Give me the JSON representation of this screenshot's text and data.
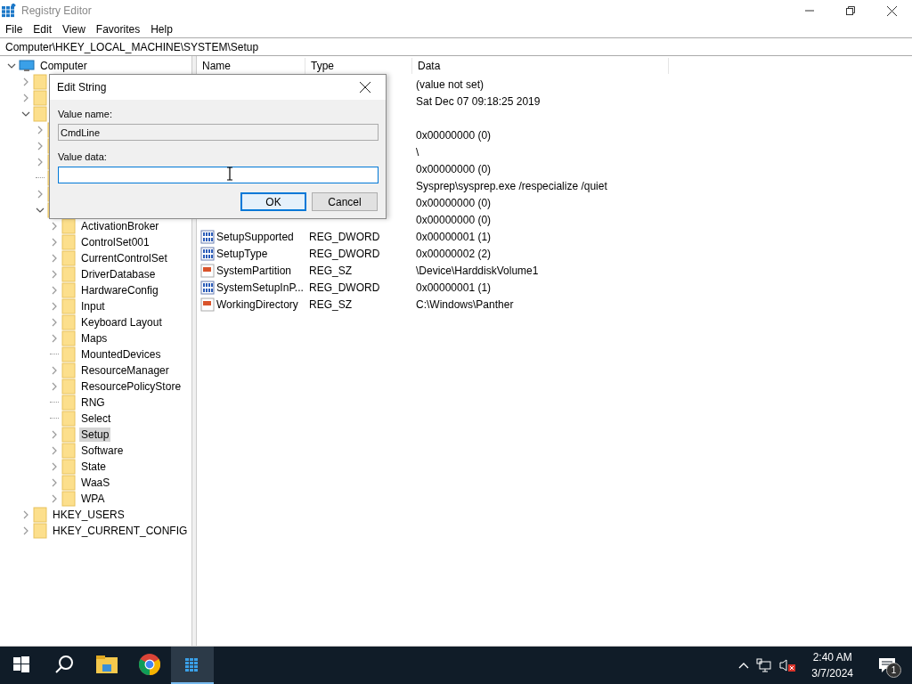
{
  "window": {
    "title": "Registry Editor"
  },
  "menu": [
    "File",
    "Edit",
    "View",
    "Favorites",
    "Help"
  ],
  "address": "Computer\\HKEY_LOCAL_MACHINE\\SYSTEM\\Setup",
  "tree": [
    {
      "label": "Computer",
      "expanded": true,
      "kind": "computer",
      "children": [
        {
          "kind": "key",
          "expanded": false
        },
        {
          "kind": "key",
          "expanded": false
        },
        {
          "kind": "key",
          "expanded": true,
          "children": [
            {
              "kind": "key",
              "expanded": false
            },
            {
              "kind": "key",
              "expanded": false
            },
            {
              "kind": "key",
              "expanded": false
            },
            {
              "kind": "key"
            },
            {
              "kind": "key",
              "expanded": false
            },
            {
              "kind": "key",
              "expanded": true,
              "children": [
                {
                  "kind": "key",
                  "label": "ActivationBroker",
                  "expanded": false,
                  "selected": false
                },
                {
                  "kind": "key",
                  "label": "ControlSet001",
                  "expanded": false,
                  "selected": false
                },
                {
                  "kind": "key",
                  "label": "CurrentControlSet",
                  "expanded": false,
                  "selected": false
                },
                {
                  "kind": "key",
                  "label": "DriverDatabase",
                  "expanded": false,
                  "selected": false
                },
                {
                  "kind": "key",
                  "label": "HardwareConfig",
                  "expanded": false,
                  "selected": false
                },
                {
                  "kind": "key",
                  "label": "Input",
                  "expanded": false,
                  "selected": false
                },
                {
                  "kind": "key",
                  "label": "Keyboard Layout",
                  "expanded": false,
                  "selected": false
                },
                {
                  "kind": "key",
                  "label": "Maps",
                  "expanded": false,
                  "selected": false
                },
                {
                  "kind": "key",
                  "label": "MountedDevices",
                  "selected": false
                },
                {
                  "kind": "key",
                  "label": "ResourceManager",
                  "expanded": false,
                  "selected": false
                },
                {
                  "kind": "key",
                  "label": "ResourcePolicyStore",
                  "expanded": false,
                  "selected": false
                },
                {
                  "kind": "key",
                  "label": "RNG",
                  "selected": false
                },
                {
                  "kind": "key",
                  "label": "Select",
                  "selected": false
                },
                {
                  "kind": "key",
                  "label": "Setup",
                  "expanded": false,
                  "selected": true
                },
                {
                  "kind": "key",
                  "label": "Software",
                  "expanded": false,
                  "selected": false
                },
                {
                  "kind": "key",
                  "label": "State",
                  "expanded": false,
                  "selected": false
                },
                {
                  "kind": "key",
                  "label": "WaaS",
                  "expanded": false,
                  "selected": false
                },
                {
                  "kind": "key",
                  "label": "WPA",
                  "expanded": false,
                  "selected": false
                }
              ]
            }
          ]
        },
        {
          "kind": "key",
          "label": "HKEY_USERS",
          "expanded": false,
          "selected": false
        },
        {
          "kind": "key",
          "label": "HKEY_CURRENT_CONFIG",
          "expanded": false,
          "selected": false
        }
      ]
    }
  ],
  "columns": [
    "Name",
    "Type",
    "Data"
  ],
  "rows": [
    {
      "data": "(value not set)"
    },
    {
      "data": "Sat Dec 07 09:18:25 2019"
    },
    {},
    {
      "data": "0x00000000 (0)"
    },
    {
      "data": "\\"
    },
    {
      "data": "0x00000000 (0)"
    },
    {
      "data": "Sysprep\\sysprep.exe /respecialize /quiet"
    },
    {
      "data": "0x00000000 (0)"
    },
    {
      "data": "0x00000000 (0)"
    },
    {
      "kind": "dword",
      "name": "SetupSupported",
      "type": "REG_DWORD",
      "data": "0x00000001 (1)"
    },
    {
      "kind": "dword",
      "name": "SetupType",
      "type": "REG_DWORD",
      "data": "0x00000002 (2)"
    },
    {
      "kind": "string",
      "name": "SystemPartition",
      "type": "REG_SZ",
      "data": "\\Device\\HarddiskVolume1"
    },
    {
      "kind": "dword",
      "name": "SystemSetupInP...",
      "type": "REG_DWORD",
      "data": "0x00000001 (1)"
    },
    {
      "kind": "string",
      "name": "WorkingDirectory",
      "type": "REG_SZ",
      "data": "C:\\Windows\\Panther"
    }
  ],
  "dialog": {
    "title": "Edit String",
    "name_label": "Value name:",
    "name_value": "CmdLine",
    "data_label": "Value data:",
    "buttons": [
      {
        "label": "OK",
        "default": true
      },
      {
        "label": "Cancel",
        "default": false
      }
    ]
  },
  "taskbar": {
    "apps": [
      {
        "kind": "explorer",
        "active": false
      },
      {
        "kind": "chrome",
        "active": false
      },
      {
        "kind": "regedit",
        "active": true
      }
    ],
    "time": "2:40 AM",
    "date": "3/7/2024",
    "notifications": "1"
  }
}
